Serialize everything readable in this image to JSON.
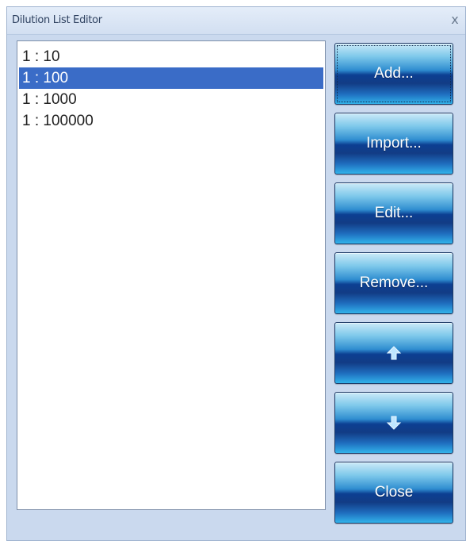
{
  "window": {
    "title": "Dilution List Editor",
    "close_glyph": "x"
  },
  "list": {
    "items": [
      {
        "label": "1 : 10",
        "selected": false
      },
      {
        "label": "1 : 100",
        "selected": true
      },
      {
        "label": "1 : 1000",
        "selected": false
      },
      {
        "label": "1 : 100000",
        "selected": false
      }
    ]
  },
  "buttons": {
    "add": "Add...",
    "import": "Import...",
    "edit": "Edit...",
    "remove": "Remove...",
    "move_up_icon": "arrow-up-icon",
    "move_down_icon": "arrow-down-icon",
    "close": "Close"
  },
  "colors": {
    "selection": "#3a6cc7",
    "dialog_background": "#cad9ee",
    "button_dark": "#0c3f92",
    "button_light": "#32b3ea",
    "arrow_fill": "#bfe6ff"
  }
}
